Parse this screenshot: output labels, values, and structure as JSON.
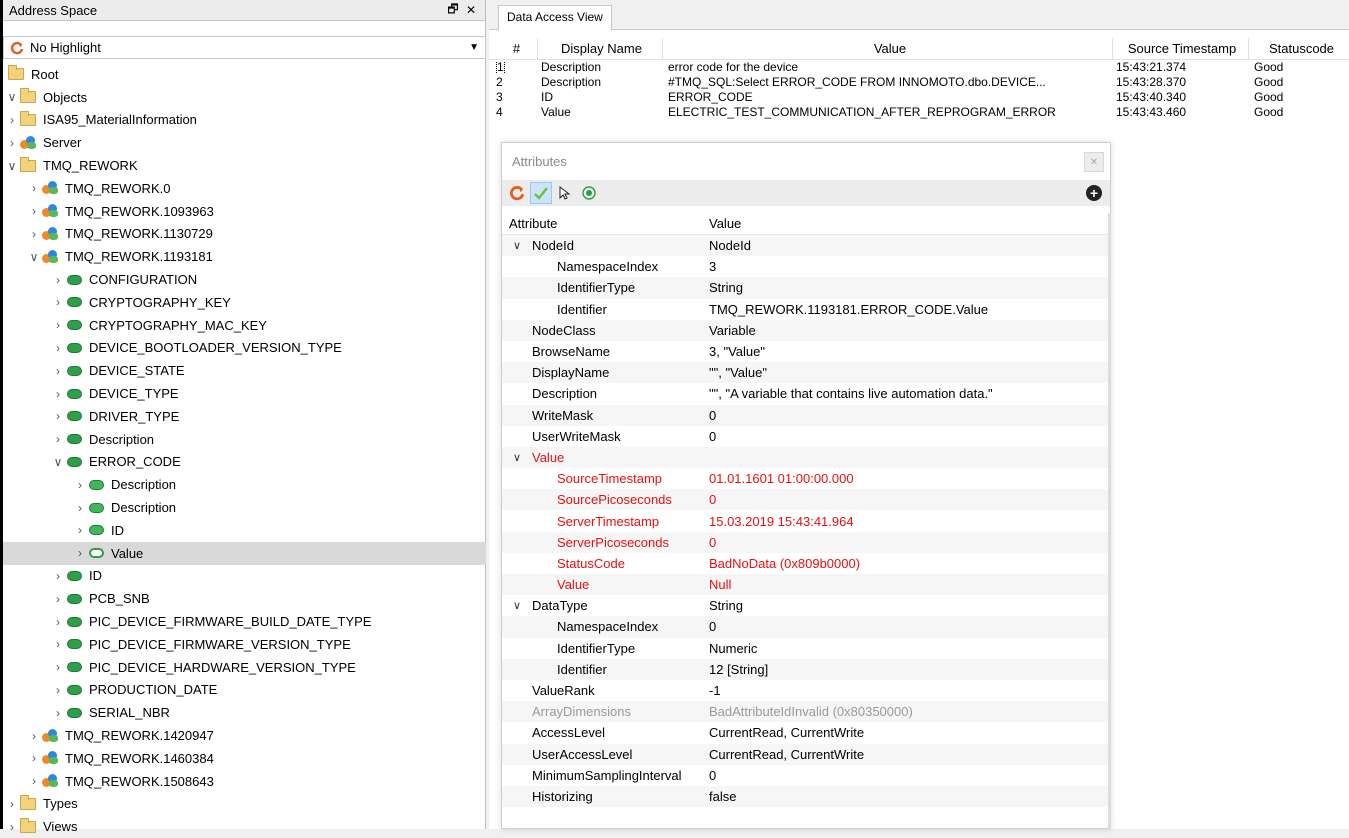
{
  "address_space": {
    "title": "Address Space",
    "highlight": "No Highlight",
    "tree": [
      {
        "label": "Root",
        "level": 0,
        "icon": "folder",
        "chevron": ""
      },
      {
        "label": "Objects",
        "level": 0,
        "icon": "folder",
        "chevron": "down"
      },
      {
        "label": "ISA95_MaterialInformation",
        "level": 1,
        "icon": "folder",
        "chevron": "right"
      },
      {
        "label": "Server",
        "level": 1,
        "icon": "object",
        "chevron": "right"
      },
      {
        "label": "TMQ_REWORK",
        "level": 1,
        "icon": "folder",
        "chevron": "down"
      },
      {
        "label": "TMQ_REWORK.0",
        "level": 2,
        "icon": "object",
        "chevron": "right"
      },
      {
        "label": "TMQ_REWORK.1093963",
        "level": 2,
        "icon": "object",
        "chevron": "right"
      },
      {
        "label": "TMQ_REWORK.1130729",
        "level": 2,
        "icon": "object",
        "chevron": "right"
      },
      {
        "label": "TMQ_REWORK.1193181",
        "level": 2,
        "icon": "object",
        "chevron": "down"
      },
      {
        "label": "CONFIGURATION",
        "level": 3,
        "icon": "variable",
        "chevron": "right"
      },
      {
        "label": "CRYPTOGRAPHY_KEY",
        "level": 3,
        "icon": "variable",
        "chevron": "right"
      },
      {
        "label": "CRYPTOGRAPHY_MAC_KEY",
        "level": 3,
        "icon": "variable",
        "chevron": "right"
      },
      {
        "label": "DEVICE_BOOTLOADER_VERSION_TYPE",
        "level": 3,
        "icon": "variable",
        "chevron": "right"
      },
      {
        "label": "DEVICE_STATE",
        "level": 3,
        "icon": "variable",
        "chevron": "right"
      },
      {
        "label": "DEVICE_TYPE",
        "level": 3,
        "icon": "variable",
        "chevron": "right"
      },
      {
        "label": "DRIVER_TYPE",
        "level": 3,
        "icon": "variable",
        "chevron": "right"
      },
      {
        "label": "Description",
        "level": 3,
        "icon": "variable",
        "chevron": "right"
      },
      {
        "label": "ERROR_CODE",
        "level": 3,
        "icon": "variable",
        "chevron": "down"
      },
      {
        "label": "Description",
        "level": 4,
        "icon": "property",
        "chevron": "right"
      },
      {
        "label": "Description",
        "level": 4,
        "icon": "property",
        "chevron": "right"
      },
      {
        "label": "ID",
        "level": 4,
        "icon": "property",
        "chevron": "right"
      },
      {
        "label": "Value",
        "level": 4,
        "icon": "property-hollow",
        "chevron": "right",
        "selected": true
      },
      {
        "label": "ID",
        "level": 3,
        "icon": "variable",
        "chevron": "right"
      },
      {
        "label": "PCB_SNB",
        "level": 3,
        "icon": "variable",
        "chevron": "right"
      },
      {
        "label": "PIC_DEVICE_FIRMWARE_BUILD_DATE_TYPE",
        "level": 3,
        "icon": "variable",
        "chevron": "right"
      },
      {
        "label": "PIC_DEVICE_FIRMWARE_VERSION_TYPE",
        "level": 3,
        "icon": "variable",
        "chevron": "right"
      },
      {
        "label": "PIC_DEVICE_HARDWARE_VERSION_TYPE",
        "level": 3,
        "icon": "variable",
        "chevron": "right"
      },
      {
        "label": "PRODUCTION_DATE",
        "level": 3,
        "icon": "variable",
        "chevron": "right"
      },
      {
        "label": "SERIAL_NBR",
        "level": 3,
        "icon": "variable",
        "chevron": "right"
      },
      {
        "label": "TMQ_REWORK.1420947",
        "level": 2,
        "icon": "object",
        "chevron": "right"
      },
      {
        "label": "TMQ_REWORK.1460384",
        "level": 2,
        "icon": "object",
        "chevron": "right"
      },
      {
        "label": "TMQ_REWORK.1508643",
        "level": 2,
        "icon": "object",
        "chevron": "right"
      },
      {
        "label": "Types",
        "level": 0,
        "icon": "folder",
        "chevron": "right"
      },
      {
        "label": "Views",
        "level": 0,
        "icon": "folder",
        "chevron": "right"
      }
    ]
  },
  "data_access": {
    "tab": "Data Access View",
    "columns": [
      "#",
      "Display Name",
      "Value",
      "Source Timestamp",
      "Statuscode"
    ],
    "rows": [
      {
        "num": "1",
        "name": "Description",
        "value": "error code for the device",
        "timestamp": "15:43:21.374",
        "status": "Good"
      },
      {
        "num": "2",
        "name": "Description",
        "value": "#TMQ_SQL:Select ERROR_CODE FROM INNOMOTO.dbo.DEVICE...",
        "timestamp": "15:43:28.370",
        "status": "Good"
      },
      {
        "num": "3",
        "name": "ID",
        "value": "ERROR_CODE",
        "timestamp": "15:43:40.340",
        "status": "Good"
      },
      {
        "num": "4",
        "name": "Value",
        "value": "ELECTRIC_TEST_COMMUNICATION_AFTER_REPROGRAM_ERROR",
        "timestamp": "15:43:43.460",
        "status": "Good"
      }
    ]
  },
  "attributes": {
    "title": "Attributes",
    "columns": [
      "Attribute",
      "Value"
    ],
    "rows": [
      {
        "name": "NodeId",
        "value": "NodeId",
        "level": 0,
        "expand": true,
        "style": ""
      },
      {
        "name": "NamespaceIndex",
        "value": "3",
        "level": 1,
        "style": ""
      },
      {
        "name": "IdentifierType",
        "value": "String",
        "level": 1,
        "style": ""
      },
      {
        "name": "Identifier",
        "value": "TMQ_REWORK.1193181.ERROR_CODE.Value",
        "level": 1,
        "style": ""
      },
      {
        "name": "NodeClass",
        "value": "Variable",
        "level": 0,
        "style": ""
      },
      {
        "name": "BrowseName",
        "value": "3, \"Value\"",
        "level": 0,
        "style": ""
      },
      {
        "name": "DisplayName",
        "value": "\"\", \"Value\"",
        "level": 0,
        "style": ""
      },
      {
        "name": "Description",
        "value": "\"\", \"A variable that contains live automation data.\"",
        "level": 0,
        "style": ""
      },
      {
        "name": "WriteMask",
        "value": "0",
        "level": 0,
        "style": ""
      },
      {
        "name": "UserWriteMask",
        "value": "0",
        "level": 0,
        "style": ""
      },
      {
        "name": "Value",
        "value": "",
        "level": 0,
        "expand": true,
        "style": "red"
      },
      {
        "name": "SourceTimestamp",
        "value": "01.01.1601 01:00:00.000",
        "level": 1,
        "style": "red"
      },
      {
        "name": "SourcePicoseconds",
        "value": "0",
        "level": 1,
        "style": "red"
      },
      {
        "name": "ServerTimestamp",
        "value": "15.03.2019 15:43:41.964",
        "level": 1,
        "style": "red"
      },
      {
        "name": "ServerPicoseconds",
        "value": "0",
        "level": 1,
        "style": "red"
      },
      {
        "name": "StatusCode",
        "value": "BadNoData (0x809b0000)",
        "level": 1,
        "style": "red"
      },
      {
        "name": "Value",
        "value": "Null",
        "level": 1,
        "style": "red"
      },
      {
        "name": "DataType",
        "value": "String",
        "level": 0,
        "expand": true,
        "style": ""
      },
      {
        "name": "NamespaceIndex",
        "value": "0",
        "level": 1,
        "style": ""
      },
      {
        "name": "IdentifierType",
        "value": "Numeric",
        "level": 1,
        "style": ""
      },
      {
        "name": "Identifier",
        "value": "12 [String]",
        "level": 1,
        "style": ""
      },
      {
        "name": "ValueRank",
        "value": "-1",
        "level": 0,
        "style": ""
      },
      {
        "name": "ArrayDimensions",
        "value": "BadAttributeIdInvalid (0x80350000)",
        "level": 0,
        "style": "gray"
      },
      {
        "name": "AccessLevel",
        "value": "CurrentRead, CurrentWrite",
        "level": 0,
        "style": ""
      },
      {
        "name": "UserAccessLevel",
        "value": "CurrentRead, CurrentWrite",
        "level": 0,
        "style": ""
      },
      {
        "name": "MinimumSamplingInterval",
        "value": "0",
        "level": 0,
        "style": ""
      },
      {
        "name": "Historizing",
        "value": "false",
        "level": 0,
        "style": ""
      }
    ]
  },
  "icons": {
    "refresh": "refresh-icon",
    "check": "check-icon",
    "cursor": "cursor-icon",
    "radio": "target-icon",
    "add": "add-icon",
    "float": "float-window-icon",
    "close": "close-icon"
  },
  "colors": {
    "error": "#e8100f",
    "disabled": "#9a9a9a",
    "selection": "#d9d9d9"
  }
}
